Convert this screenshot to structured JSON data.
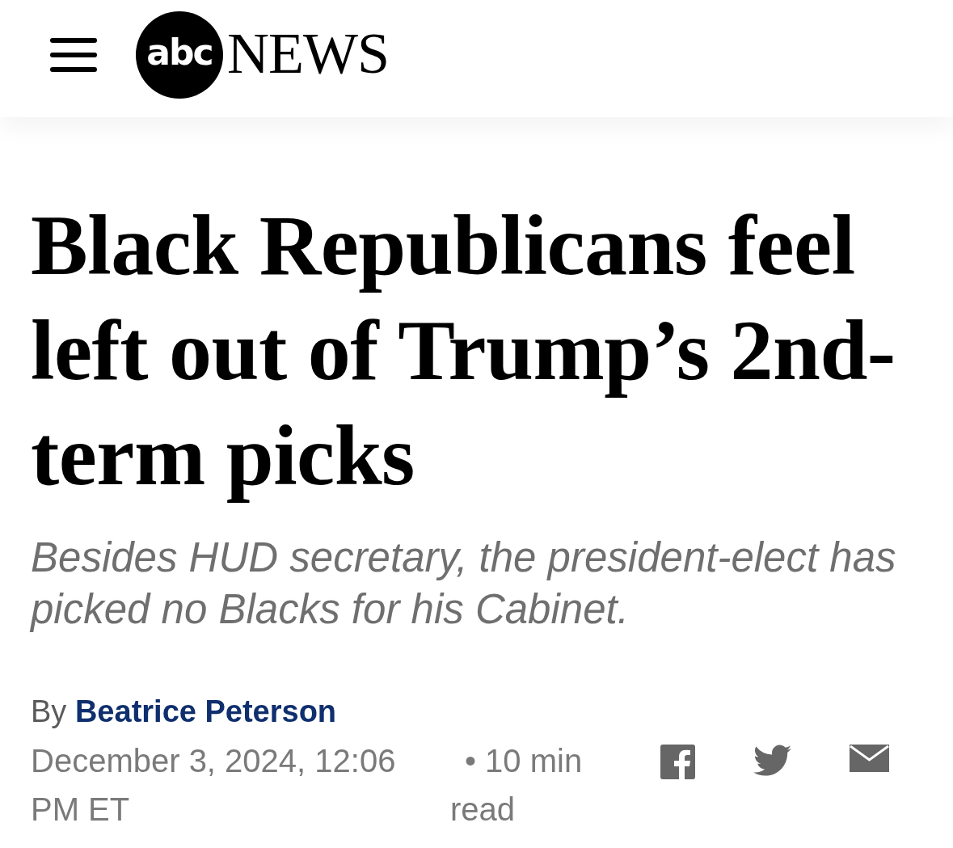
{
  "header": {
    "logo": {
      "badge_text": "abc",
      "wordmark": "NEWS"
    }
  },
  "article": {
    "headline": "Black Republicans feel left out of Trump’s 2nd-term picks",
    "subheadline": "Besides HUD secretary, the president-elect has picked no Blacks for his Cabinet.",
    "byline": {
      "prefix": "By",
      "author": "Beatrice Peterson"
    },
    "published": "December 3, 2024, 12:06 PM ET",
    "read_time": "• 10 min read"
  },
  "share_buttons": [
    {
      "kind": "facebook"
    },
    {
      "kind": "twitter"
    },
    {
      "kind": "email"
    }
  ]
}
